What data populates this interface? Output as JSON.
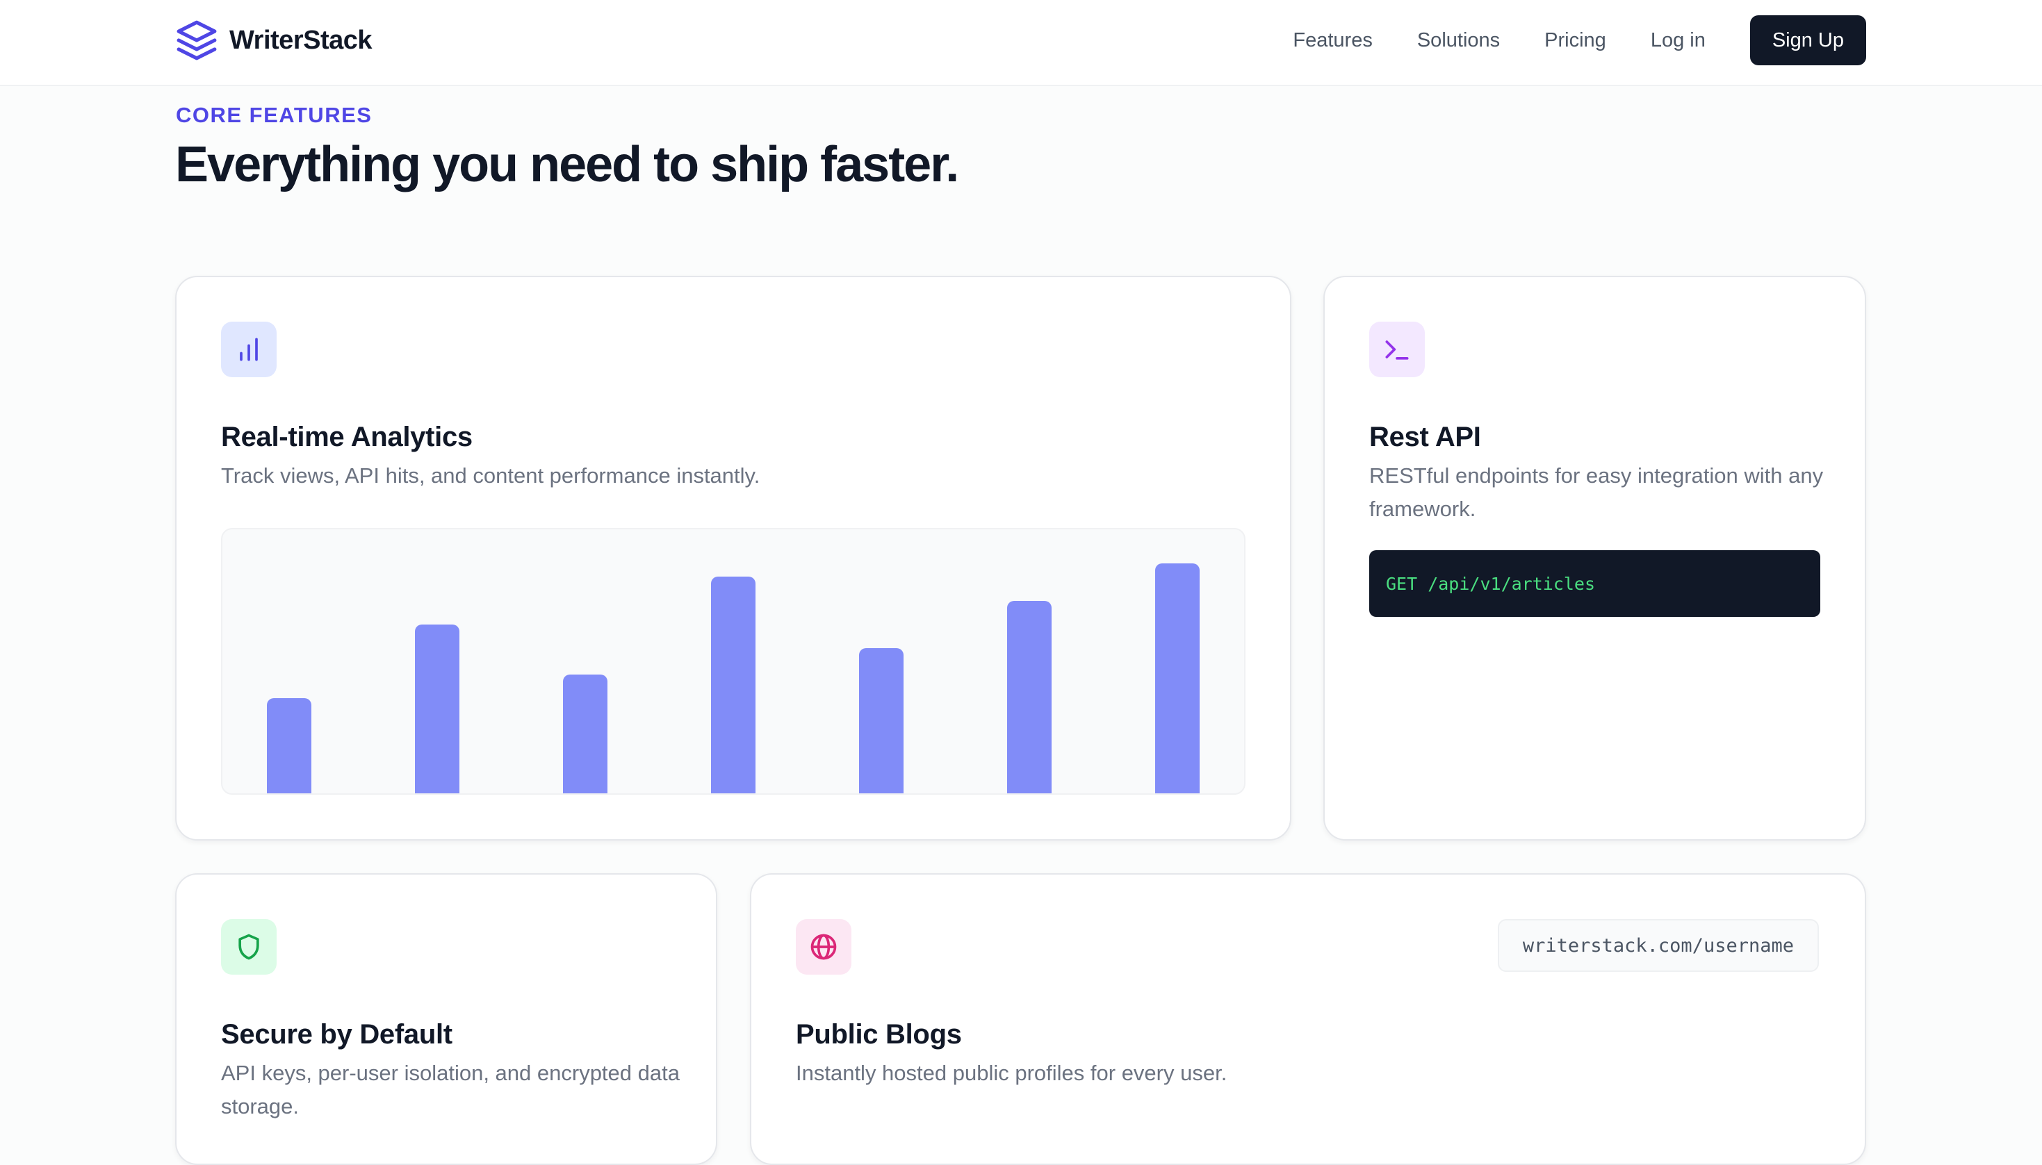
{
  "nav": {
    "brand": "WriterStack",
    "links": [
      "Features",
      "Solutions",
      "Pricing",
      "Log in"
    ],
    "signup": "Sign Up"
  },
  "hero": {
    "eyebrow": "CORE FEATURES",
    "title": "Everything you need to ship faster."
  },
  "cards": {
    "analytics": {
      "title": "Real-time Analytics",
      "description": "Track views, API hits, and content performance instantly.",
      "icon": "bar-chart-icon"
    },
    "rest_api": {
      "title": "Rest API",
      "description": "RESTful endpoints for easy integration with any framework.",
      "code": "GET /api/v1/articles",
      "icon": "terminal-icon"
    },
    "secure": {
      "title": "Secure by Default",
      "description": "API keys, per-user isolation, and encrypted data storage.",
      "icon": "shield-icon"
    },
    "blogs": {
      "title": "Public Blogs",
      "description": "Instantly hosted public profiles for every user.",
      "url": "writerstack.com/username",
      "icon": "globe-icon"
    }
  },
  "colors": {
    "accent": "#4f46e5",
    "bar": "#818cf8",
    "code_bg": "#111827",
    "code_text": "#4ade80"
  },
  "chart_data": {
    "type": "bar",
    "categories": [],
    "values": [
      0.36,
      0.64,
      0.45,
      0.82,
      0.55,
      0.73,
      0.87
    ],
    "ylim": [
      0,
      1
    ],
    "grid": false
  }
}
